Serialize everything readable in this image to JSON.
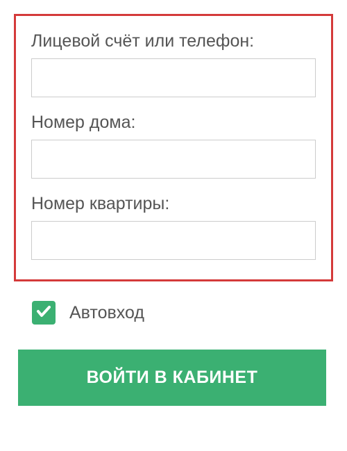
{
  "form": {
    "fields": {
      "account": {
        "label": "Лицевой счёт или телефон:",
        "value": ""
      },
      "house": {
        "label": "Номер дома:",
        "value": ""
      },
      "apartment": {
        "label": "Номер квартиры:",
        "value": ""
      }
    },
    "autologin": {
      "label": "Автовход",
      "checked": true
    },
    "submit_label": "ВОЙТИ В КАБИНЕТ"
  },
  "colors": {
    "accent": "#3bb072",
    "highlight_border": "#d43a3a"
  }
}
